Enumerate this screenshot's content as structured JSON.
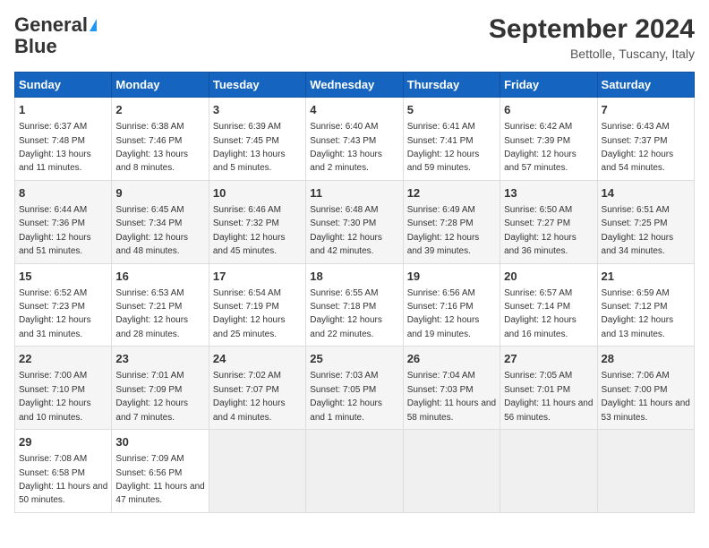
{
  "logo": {
    "line1": "General",
    "line2": "Blue"
  },
  "title": "September 2024",
  "location": "Bettolle, Tuscany, Italy",
  "days_of_week": [
    "Sunday",
    "Monday",
    "Tuesday",
    "Wednesday",
    "Thursday",
    "Friday",
    "Saturday"
  ],
  "weeks": [
    [
      {
        "day": 1,
        "sunrise": "6:37 AM",
        "sunset": "7:48 PM",
        "daylight": "13 hours and 11 minutes."
      },
      {
        "day": 2,
        "sunrise": "6:38 AM",
        "sunset": "7:46 PM",
        "daylight": "13 hours and 8 minutes."
      },
      {
        "day": 3,
        "sunrise": "6:39 AM",
        "sunset": "7:45 PM",
        "daylight": "13 hours and 5 minutes."
      },
      {
        "day": 4,
        "sunrise": "6:40 AM",
        "sunset": "7:43 PM",
        "daylight": "13 hours and 2 minutes."
      },
      {
        "day": 5,
        "sunrise": "6:41 AM",
        "sunset": "7:41 PM",
        "daylight": "12 hours and 59 minutes."
      },
      {
        "day": 6,
        "sunrise": "6:42 AM",
        "sunset": "7:39 PM",
        "daylight": "12 hours and 57 minutes."
      },
      {
        "day": 7,
        "sunrise": "6:43 AM",
        "sunset": "7:37 PM",
        "daylight": "12 hours and 54 minutes."
      }
    ],
    [
      {
        "day": 8,
        "sunrise": "6:44 AM",
        "sunset": "7:36 PM",
        "daylight": "12 hours and 51 minutes."
      },
      {
        "day": 9,
        "sunrise": "6:45 AM",
        "sunset": "7:34 PM",
        "daylight": "12 hours and 48 minutes."
      },
      {
        "day": 10,
        "sunrise": "6:46 AM",
        "sunset": "7:32 PM",
        "daylight": "12 hours and 45 minutes."
      },
      {
        "day": 11,
        "sunrise": "6:48 AM",
        "sunset": "7:30 PM",
        "daylight": "12 hours and 42 minutes."
      },
      {
        "day": 12,
        "sunrise": "6:49 AM",
        "sunset": "7:28 PM",
        "daylight": "12 hours and 39 minutes."
      },
      {
        "day": 13,
        "sunrise": "6:50 AM",
        "sunset": "7:27 PM",
        "daylight": "12 hours and 36 minutes."
      },
      {
        "day": 14,
        "sunrise": "6:51 AM",
        "sunset": "7:25 PM",
        "daylight": "12 hours and 34 minutes."
      }
    ],
    [
      {
        "day": 15,
        "sunrise": "6:52 AM",
        "sunset": "7:23 PM",
        "daylight": "12 hours and 31 minutes."
      },
      {
        "day": 16,
        "sunrise": "6:53 AM",
        "sunset": "7:21 PM",
        "daylight": "12 hours and 28 minutes."
      },
      {
        "day": 17,
        "sunrise": "6:54 AM",
        "sunset": "7:19 PM",
        "daylight": "12 hours and 25 minutes."
      },
      {
        "day": 18,
        "sunrise": "6:55 AM",
        "sunset": "7:18 PM",
        "daylight": "12 hours and 22 minutes."
      },
      {
        "day": 19,
        "sunrise": "6:56 AM",
        "sunset": "7:16 PM",
        "daylight": "12 hours and 19 minutes."
      },
      {
        "day": 20,
        "sunrise": "6:57 AM",
        "sunset": "7:14 PM",
        "daylight": "12 hours and 16 minutes."
      },
      {
        "day": 21,
        "sunrise": "6:59 AM",
        "sunset": "7:12 PM",
        "daylight": "12 hours and 13 minutes."
      }
    ],
    [
      {
        "day": 22,
        "sunrise": "7:00 AM",
        "sunset": "7:10 PM",
        "daylight": "12 hours and 10 minutes."
      },
      {
        "day": 23,
        "sunrise": "7:01 AM",
        "sunset": "7:09 PM",
        "daylight": "12 hours and 7 minutes."
      },
      {
        "day": 24,
        "sunrise": "7:02 AM",
        "sunset": "7:07 PM",
        "daylight": "12 hours and 4 minutes."
      },
      {
        "day": 25,
        "sunrise": "7:03 AM",
        "sunset": "7:05 PM",
        "daylight": "12 hours and 1 minute."
      },
      {
        "day": 26,
        "sunrise": "7:04 AM",
        "sunset": "7:03 PM",
        "daylight": "11 hours and 58 minutes."
      },
      {
        "day": 27,
        "sunrise": "7:05 AM",
        "sunset": "7:01 PM",
        "daylight": "11 hours and 56 minutes."
      },
      {
        "day": 28,
        "sunrise": "7:06 AM",
        "sunset": "7:00 PM",
        "daylight": "11 hours and 53 minutes."
      }
    ],
    [
      {
        "day": 29,
        "sunrise": "7:08 AM",
        "sunset": "6:58 PM",
        "daylight": "11 hours and 50 minutes."
      },
      {
        "day": 30,
        "sunrise": "7:09 AM",
        "sunset": "6:56 PM",
        "daylight": "11 hours and 47 minutes."
      },
      null,
      null,
      null,
      null,
      null
    ]
  ]
}
